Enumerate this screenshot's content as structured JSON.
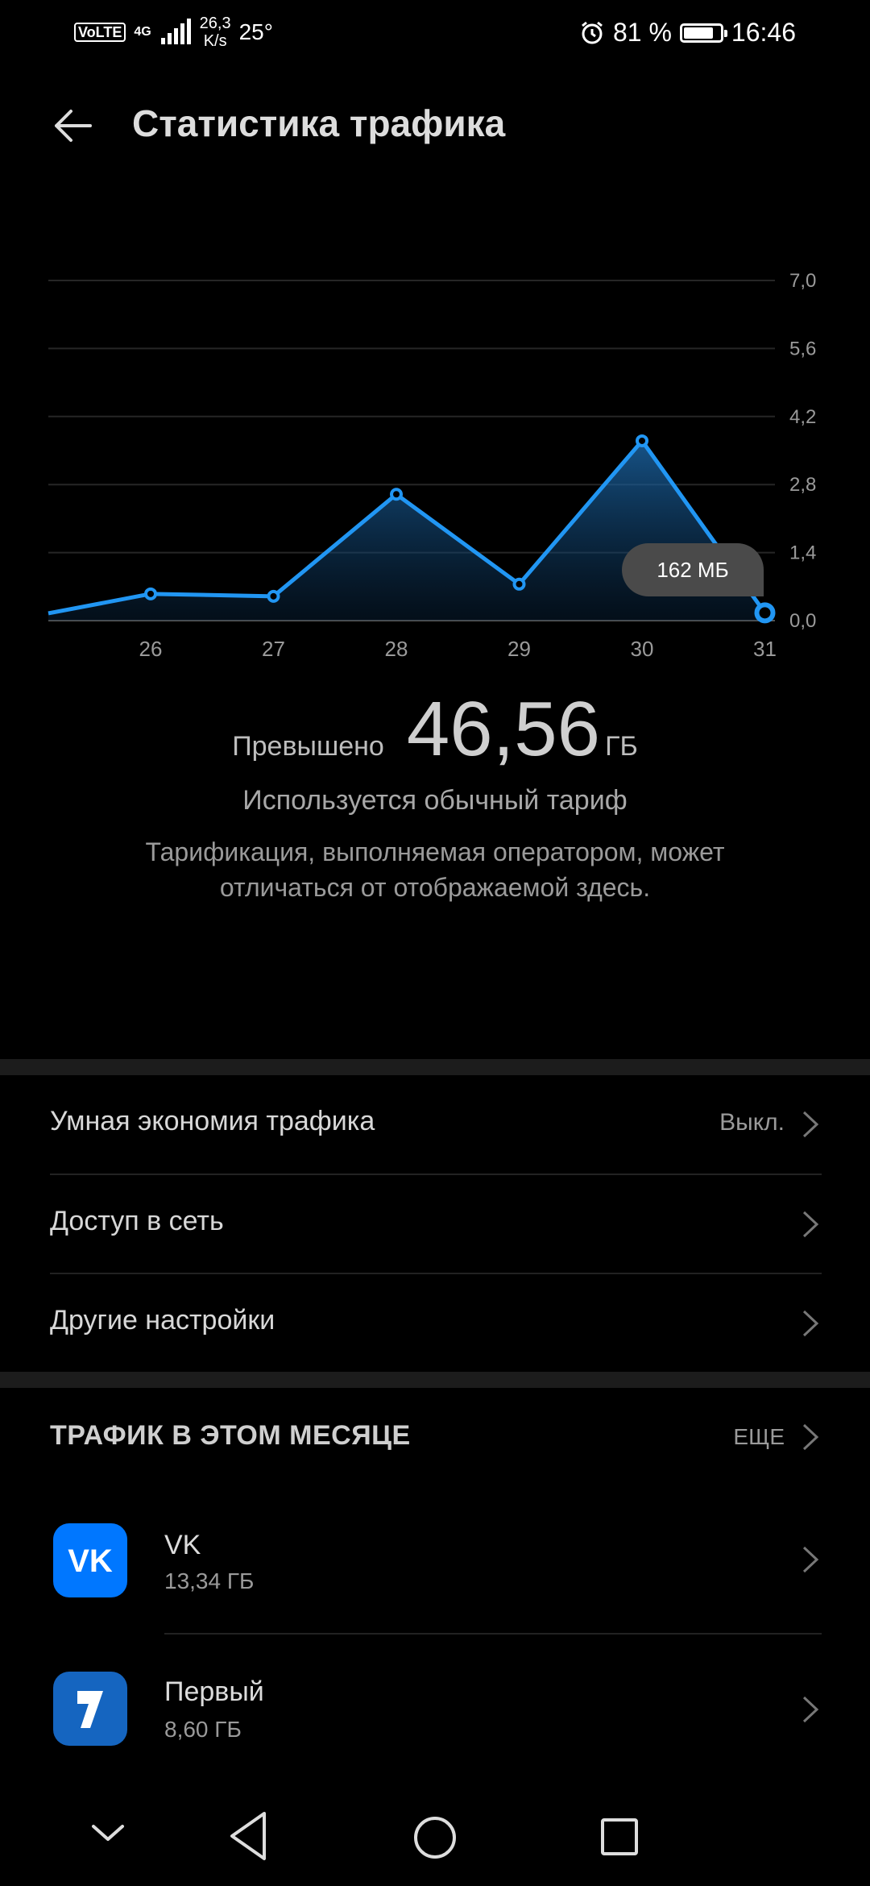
{
  "status_bar": {
    "volte": "VoLTE",
    "network": "4G",
    "speed_value": "26,3",
    "speed_unit": "K/s",
    "temperature": "25°",
    "battery": "81 %",
    "battery_level": 0.81,
    "time": "16:46",
    "icons": [
      "signal-icon",
      "alarm-icon",
      "battery-icon"
    ]
  },
  "header": {
    "title": "Статистика трафика",
    "back_icon": "back-arrow-icon"
  },
  "chart_data": {
    "type": "area",
    "x": [
      "25",
      "26",
      "27",
      "28",
      "29",
      "30",
      "31"
    ],
    "x_tick_labels": [
      "26",
      "27",
      "28",
      "29",
      "30",
      "31"
    ],
    "y": [
      0.15,
      0.55,
      0.5,
      2.6,
      0.75,
      3.7,
      0.16
    ],
    "y_tick_labels": [
      "7,0",
      "5,6",
      "4,2",
      "2,8",
      "1,4",
      "0,0"
    ],
    "ylim": [
      0,
      7.0
    ],
    "grid": true,
    "tooltip": "162 МБ",
    "color": "#2196f3"
  },
  "summary": {
    "label": "Превышено",
    "value": "46,56",
    "unit": "ГБ",
    "plan": "Используется обычный тариф",
    "note_line1": "Тарификация, выполняемая оператором, может",
    "note_line2": "отличаться от отображаемой здесь."
  },
  "settings": {
    "smart_saver": {
      "label": "Умная экономия трафика",
      "value": "Выкл."
    },
    "network_access": {
      "label": "Доступ в сеть"
    },
    "other_settings": {
      "label": "Другие настройки"
    }
  },
  "monthly": {
    "title": "ТРАФИК В ЭТОМ МЕСЯЦЕ",
    "more": "ЕЩЕ",
    "apps": [
      {
        "name": "VK",
        "size": "13,34 ГБ",
        "icon": "vk-app-icon",
        "color": "#0077ff"
      },
      {
        "name": "Первый",
        "size": "8,60 ГБ",
        "icon": "channel-one-app-icon",
        "color": "#1565c0"
      }
    ]
  },
  "nav_bar": {
    "icons": [
      "collapse-chevron-icon",
      "back-triangle-icon",
      "home-circle-icon",
      "recents-square-icon"
    ]
  }
}
